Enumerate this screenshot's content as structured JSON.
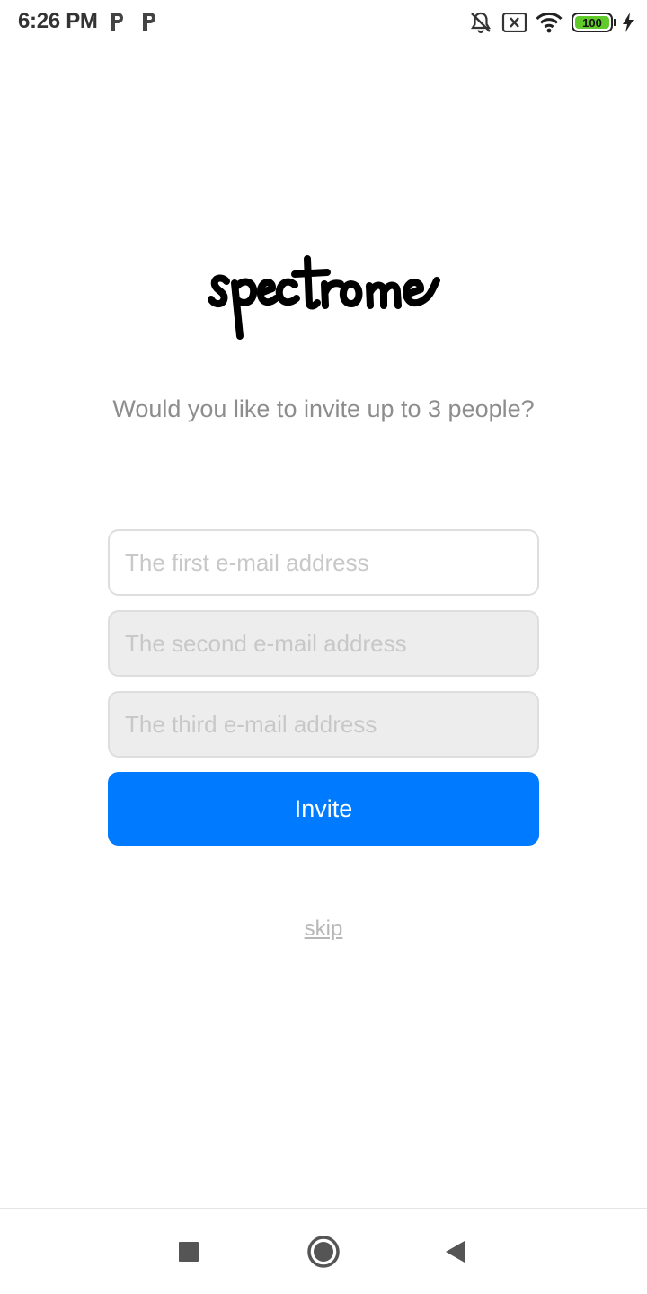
{
  "status_bar": {
    "time": "6:26 PM",
    "battery_level": "100",
    "icons": [
      "parking-icon",
      "parking-icon",
      "mute-icon",
      "sim-error-icon",
      "wifi-icon",
      "battery-icon",
      "charging-icon"
    ]
  },
  "brand": {
    "logo_text": "spectrome"
  },
  "invite": {
    "prompt": "Would you like to invite up to 3 people?",
    "email1_placeholder": "The first e-mail address",
    "email2_placeholder": "The second e-mail address",
    "email3_placeholder": "The third e-mail address",
    "invite_label": "Invite",
    "skip_label": "skip"
  },
  "nav_bar": {
    "icons": [
      "recents-icon",
      "home-icon",
      "back-icon"
    ]
  },
  "colors": {
    "accent": "#007aff",
    "prompt_text": "#8d8d8d",
    "disabled_input": "#ededed",
    "battery": "#5fca2a"
  }
}
